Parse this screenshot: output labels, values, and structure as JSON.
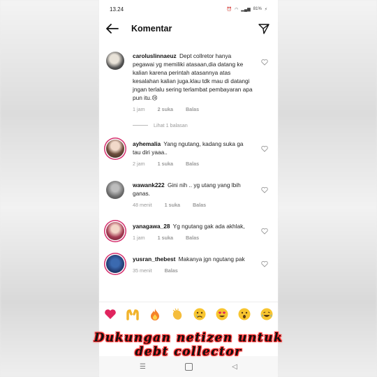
{
  "status": {
    "time": "13.24",
    "battery": "81%"
  },
  "header": {
    "title": "Komentar"
  },
  "comments": [
    {
      "username": "caroluslinnaeuz",
      "text": "Dept collretor hanya pegawai yg memiliki atasaan,dia datang ke kalian karena perintah atasannya atas kesalahan kalian juga.klau tdk mau di datangi jngan terlalu sering terlambat pembayaran apa pun itu.😢",
      "time": "1 jam",
      "likes": "2 suka",
      "reply": "Balas",
      "view_replies": "Lihat 1 balasan"
    },
    {
      "username": "ayhemalia",
      "text": "Yang ngutang, kadang suka ga tau diri yaaa..",
      "time": "2 jam",
      "likes": "1 suka",
      "reply": "Balas"
    },
    {
      "username": "wawank222",
      "text": "Gini nih .. yg utang yang lbih ganas.",
      "time": "48 menit",
      "likes": "1 suka",
      "reply": "Balas"
    },
    {
      "username": "yanagawa_28",
      "text": "Yg ngutang gak ada akhlak,",
      "time": "1 jam",
      "likes": "1 suka",
      "reply": "Balas"
    },
    {
      "username": "yusran_thebest",
      "text": "Makanya jgn ngutang pak",
      "time": "35 menit",
      "reply": "Balas"
    }
  ],
  "reactions": [
    "❤️",
    "🙌",
    "🔥",
    "👏",
    "😢",
    "😍",
    "😮",
    "😂"
  ],
  "caption": {
    "line1": "Dukungan netizen untuk",
    "line2": "debt collector"
  },
  "colors": {
    "heart_red": "#e0245e",
    "caption_glow": "#ff2a2a",
    "story_ring": "#d5306e"
  }
}
